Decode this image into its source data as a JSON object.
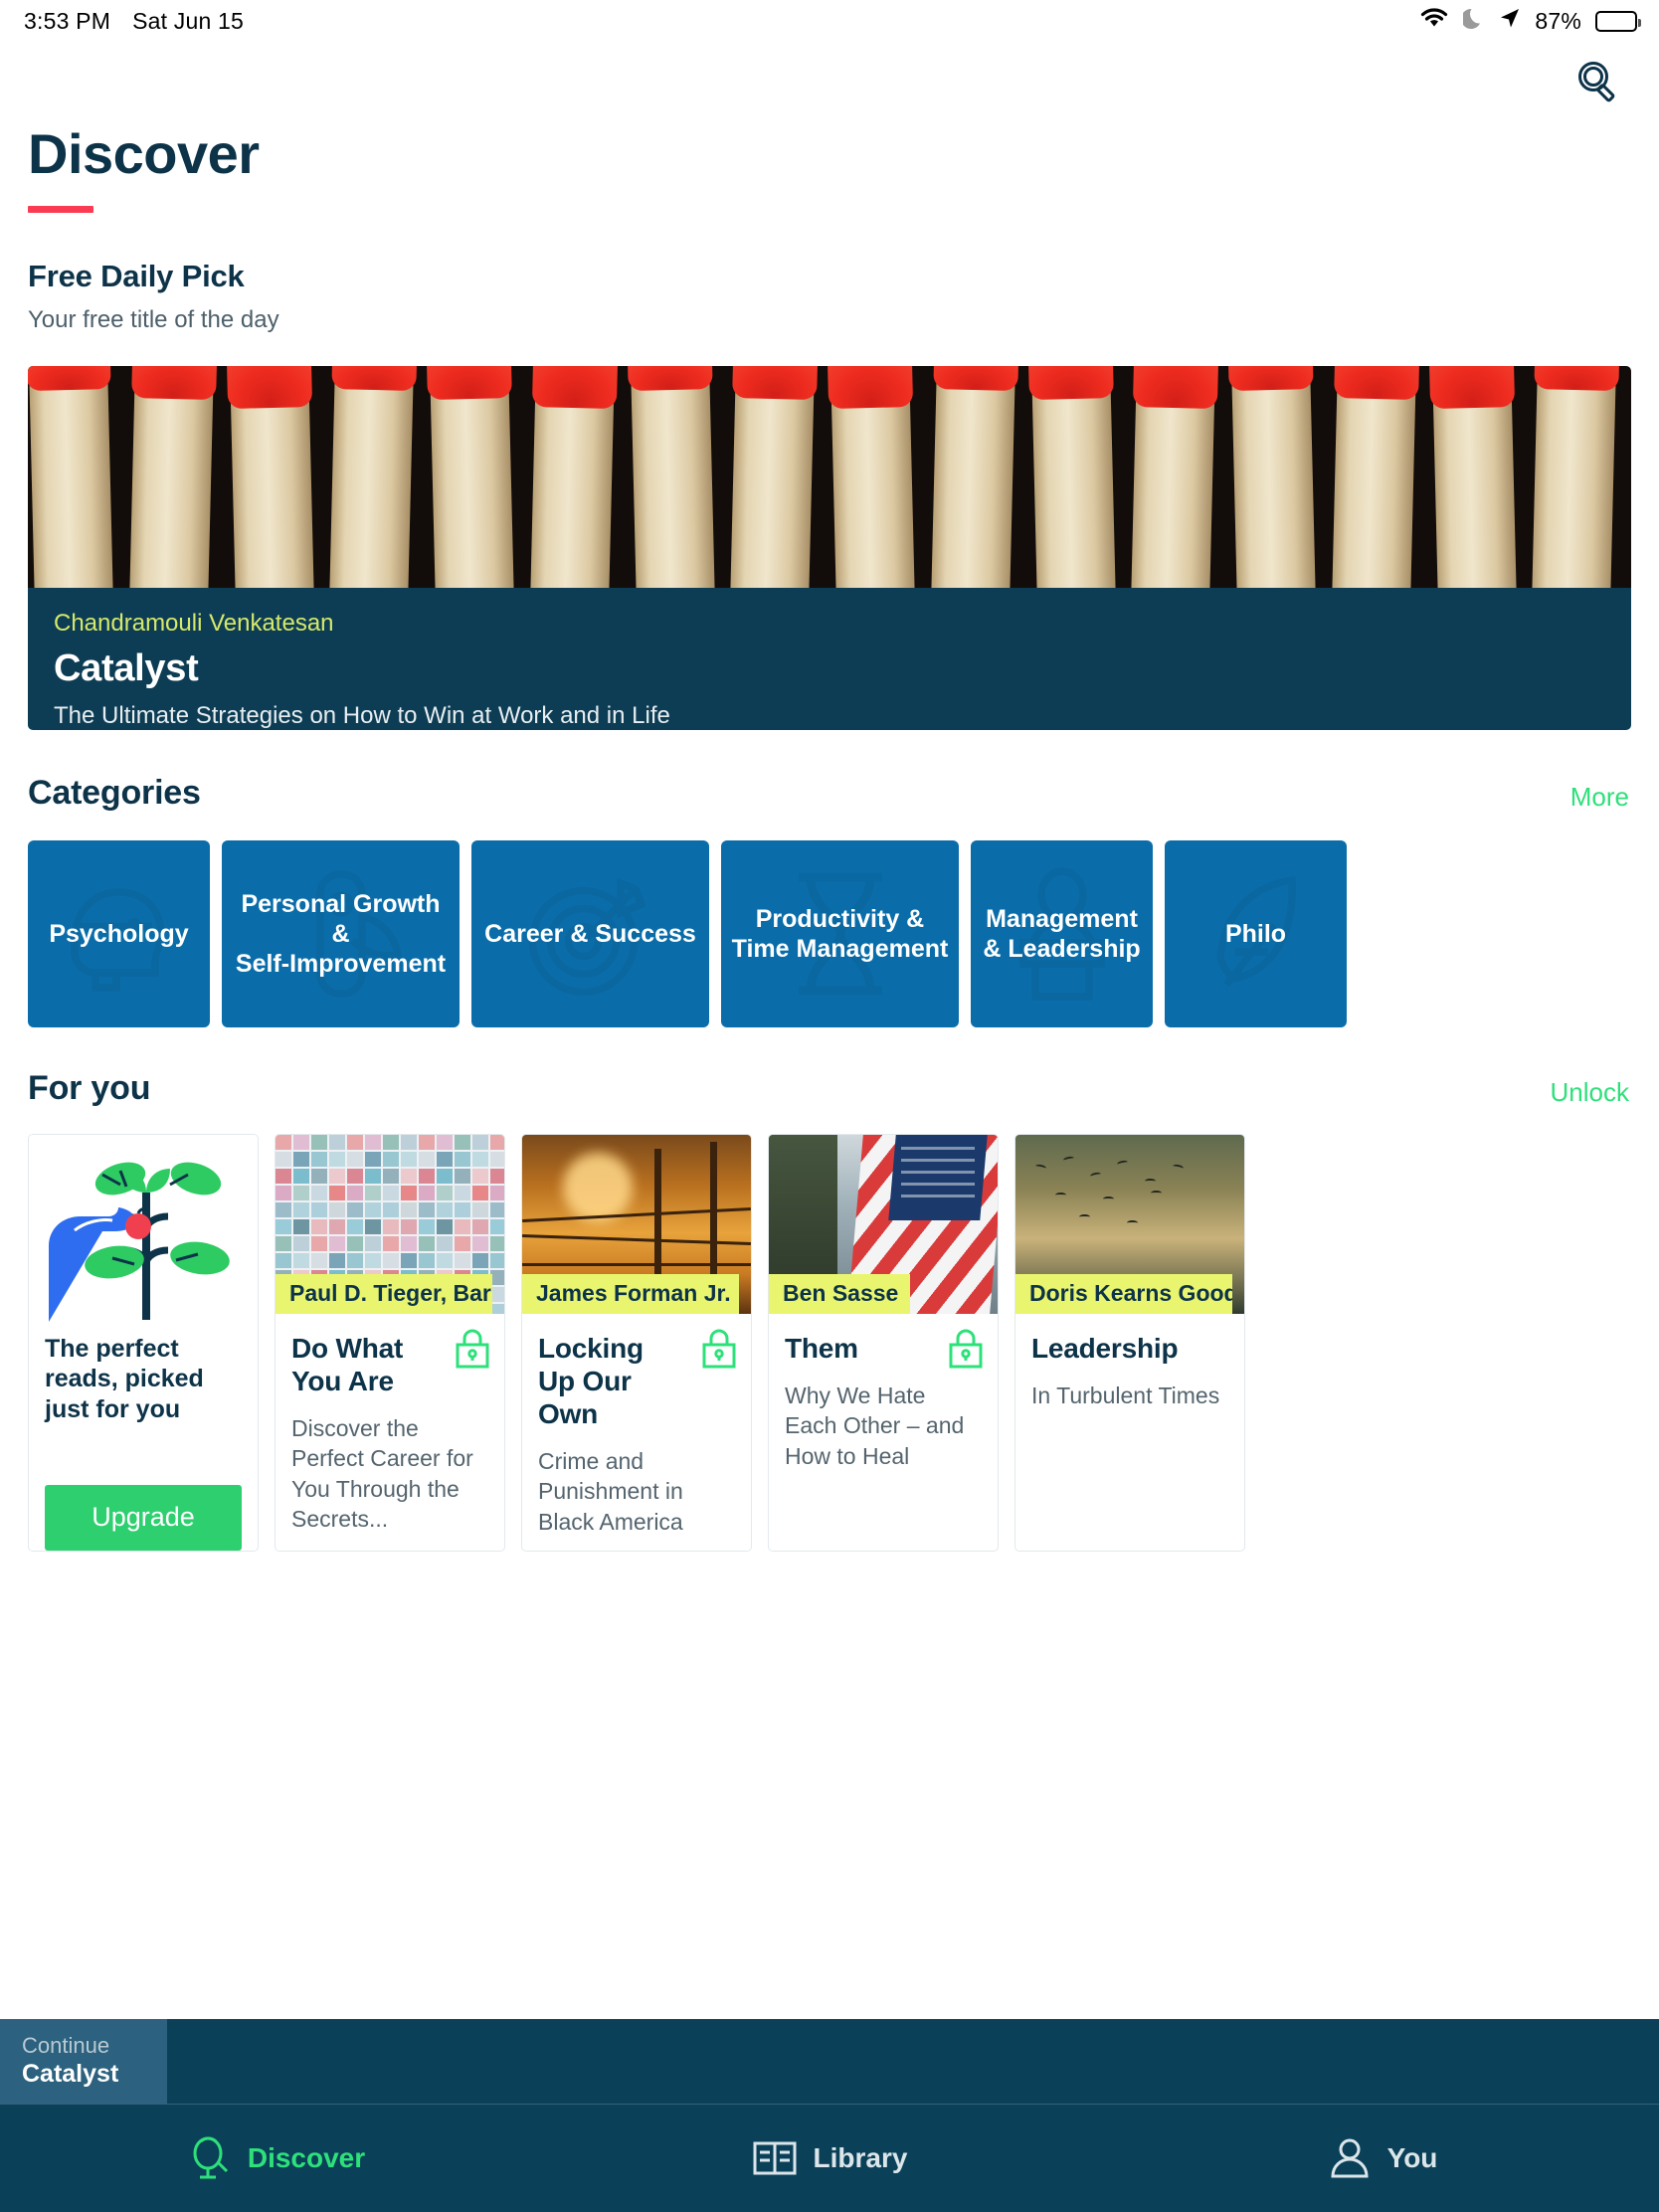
{
  "status_bar": {
    "time": "3:53 PM",
    "date": "Sat Jun 15",
    "battery_percent": "87%",
    "icons": [
      "wifi-icon",
      "moon-icon",
      "location-arrow-icon",
      "battery-icon"
    ]
  },
  "header": {
    "title": "Discover",
    "search_icon": "search-icon",
    "accent_color": "#fb3b52",
    "title_color": "#0d3349"
  },
  "daily_pick": {
    "section_title": "Free Daily Pick",
    "section_subtitle": "Your free title of the day",
    "author": "Chandramouli Venkatesan",
    "title": "Catalyst",
    "subtitle": "The Ultimate Strategies on How to Win at Work and in Life",
    "author_color": "#d7e96a",
    "card_color": "#0d3d54"
  },
  "categories": {
    "section_title": "Categories",
    "more_label": "More",
    "more_color": "#2ee07a",
    "tile_color": "#0a6da9",
    "items": [
      {
        "label": "Psychology",
        "icon": "head-brain-icon",
        "wide": false
      },
      {
        "label": "Personal Growth &\nSelf-Improvement",
        "icon": "swiss-knife-icon",
        "wide": true
      },
      {
        "label": "Career & Success",
        "icon": "target-dart-icon",
        "wide": true
      },
      {
        "label": "Productivity &\nTime Management",
        "icon": "hourglass-icon",
        "wide": true
      },
      {
        "label": "Management\n& Leadership",
        "icon": "podium-speaker-icon",
        "wide": false
      },
      {
        "label": "Philo",
        "icon": "feather-quill-icon",
        "wide": false
      }
    ]
  },
  "for_you": {
    "section_title": "For you",
    "unlock_label": "Unlock",
    "unlock_color": "#2ee07a",
    "promo": {
      "text": "The perfect reads, picked just for you",
      "button_label": "Upgrade",
      "button_color": "#2ecf6f",
      "art": "hand-picking-fruit-illustration"
    },
    "books": [
      {
        "author": "Paul D. Tieger, Barb...",
        "title": "Do What\nYou Are",
        "subtitle": "Discover the Perfect Career for You Through the Secrets...",
        "locked": true,
        "cover": "colorful-squares-cover"
      },
      {
        "author": "James Forman Jr.",
        "title": "Locking Up\nOur Own",
        "subtitle": "Crime and Punishment in Black America",
        "locked": true,
        "cover": "barbed-wire-sunset-cover"
      },
      {
        "author": "Ben Sasse",
        "title": "Them",
        "subtitle": "Why We Hate Each Other – and How to Heal",
        "locked": true,
        "cover": "american-flag-cover"
      },
      {
        "author": "Doris Kearns Good",
        "title": "Leadership",
        "subtitle": "In Turbulent Times",
        "locked": false,
        "cover": "birds-dusk-sky-cover"
      }
    ]
  },
  "continue_bar": {
    "label": "Continue",
    "title": "Catalyst"
  },
  "tab_bar": {
    "tabs": [
      {
        "label": "Discover",
        "icon": "discover-magnifier-icon",
        "active": true
      },
      {
        "label": "Library",
        "icon": "open-book-icon",
        "active": false
      },
      {
        "label": "You",
        "icon": "person-icon",
        "active": false
      }
    ],
    "active_color": "#2ee07a",
    "background": "#0a4159"
  }
}
